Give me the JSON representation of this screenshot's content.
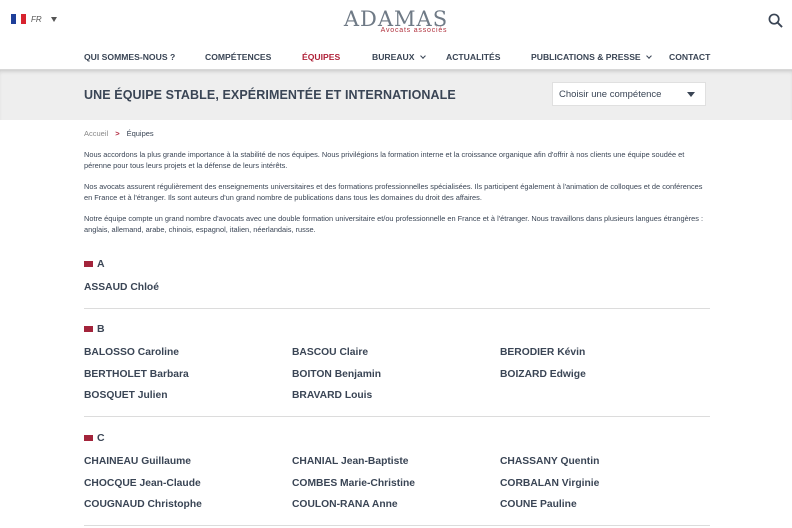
{
  "header": {
    "lang": "FR",
    "flag_colors": [
      "#1f3f99",
      "#ffffff",
      "#d8232f"
    ],
    "logo_main": "ADAMAS",
    "logo_sub": "Avocats associés",
    "search_icon": "search-icon"
  },
  "nav": [
    {
      "label": "QUI SOMMES-NOUS ?",
      "has_dropdown": false,
      "active": false
    },
    {
      "label": "COMPÉTENCES",
      "has_dropdown": false,
      "active": false
    },
    {
      "label": "ÉQUIPES",
      "has_dropdown": false,
      "active": true
    },
    {
      "label": "BUREAUX",
      "has_dropdown": true,
      "active": false
    },
    {
      "label": "ACTUALITÉS",
      "has_dropdown": false,
      "active": false
    },
    {
      "label": "PUBLICATIONS & PRESSE",
      "has_dropdown": true,
      "active": false
    },
    {
      "label": "CONTACT",
      "has_dropdown": false,
      "active": false
    }
  ],
  "banner": {
    "title": "UNE ÉQUIPE STABLE, EXPÉRIMENTÉE ET INTERNATIONALE",
    "select_value": "Choisir une compétence"
  },
  "breadcrumb": {
    "home": "Accueil",
    "separator": ">",
    "current": "Équipes"
  },
  "intro": [
    "Nous accordons la plus grande importance à la stabilité de nos équipes. Nous privilégions la formation interne et la croissance organique afin d'offrir à nos clients une équipe soudée et pérenne pour tous leurs projets et la défense de leurs intérêts.",
    "Nos avocats assurent régulièrement des enseignements universitaires et des formations professionnelles spécialisées. Ils participent également à l'animation de colloques et de conférences en France et à l'étranger. Ils sont auteurs d'un grand nombre de publications dans tous les domaines du droit des affaires.",
    "Notre équipe compte un grand nombre d'avocats avec une double formation universitaire et/ou professionnelle en France et à l'étranger. Nous travaillons dans plusieurs langues étrangères : anglais, allemand, arabe, chinois, espagnol, italien, néerlandais, russe."
  ],
  "accent_color": "#a3243b",
  "groups": [
    {
      "letter": "A",
      "members": [
        "ASSAUD Chloé"
      ]
    },
    {
      "letter": "B",
      "members": [
        "BALOSSO Caroline",
        "BASCOU Claire",
        "BERODIER Kévin",
        "BERTHOLET Barbara",
        "BOITON Benjamin",
        "BOIZARD Edwige",
        "BOSQUET Julien",
        "BRAVARD Louis"
      ]
    },
    {
      "letter": "C",
      "members": [
        "CHAINEAU Guillaume",
        "CHANIAL Jean-Baptiste",
        "CHASSANY Quentin",
        "CHOCQUE Jean-Claude",
        "COMBES Marie-Christine",
        "CORBALAN Virginie",
        "COUGNAUD Christophe",
        "COULON-RANA Anne",
        "COUNE Pauline"
      ]
    }
  ]
}
